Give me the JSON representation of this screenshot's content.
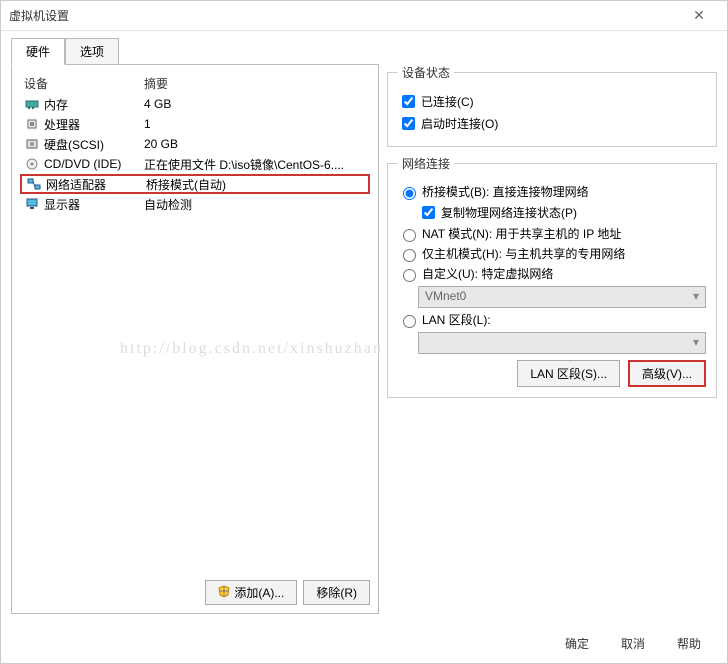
{
  "window": {
    "title": "虚拟机设置",
    "close": "✕"
  },
  "tabs": {
    "hardware": "硬件",
    "options": "选项"
  },
  "hw": {
    "col_device": "设备",
    "col_summary": "摘要",
    "items": [
      {
        "icon": "memory",
        "name": "内存",
        "summary": "4 GB"
      },
      {
        "icon": "cpu",
        "name": "处理器",
        "summary": "1"
      },
      {
        "icon": "disk",
        "name": "硬盘(SCSI)",
        "summary": "20 GB"
      },
      {
        "icon": "cd",
        "name": "CD/DVD (IDE)",
        "summary": "正在使用文件 D:\\iso镜像\\CentOS-6...."
      },
      {
        "icon": "net",
        "name": "网络适配器",
        "summary": "桥接模式(自动)"
      },
      {
        "icon": "display",
        "name": "显示器",
        "summary": "自动检测"
      }
    ],
    "add_btn": "添加(A)...",
    "remove_btn": "移除(R)"
  },
  "status": {
    "legend": "设备状态",
    "connected": "已连接(C)",
    "connect_on_start": "启动时连接(O)"
  },
  "net": {
    "legend": "网络连接",
    "bridged": "桥接模式(B): 直接连接物理网络",
    "replicate": "复制物理网络连接状态(P)",
    "nat": "NAT 模式(N): 用于共享主机的 IP 地址",
    "hostonly": "仅主机模式(H): 与主机共享的专用网络",
    "custom": "自定义(U): 特定虚拟网络",
    "custom_val": "VMnet0",
    "lan": "LAN 区段(L):",
    "lan_btn": "LAN 区段(S)...",
    "advanced_btn": "高级(V)..."
  },
  "dialog": {
    "ok": "确定",
    "cancel": "取消",
    "help": "帮助"
  },
  "watermark": "http://blog.csdn.net/xinshuzhan"
}
